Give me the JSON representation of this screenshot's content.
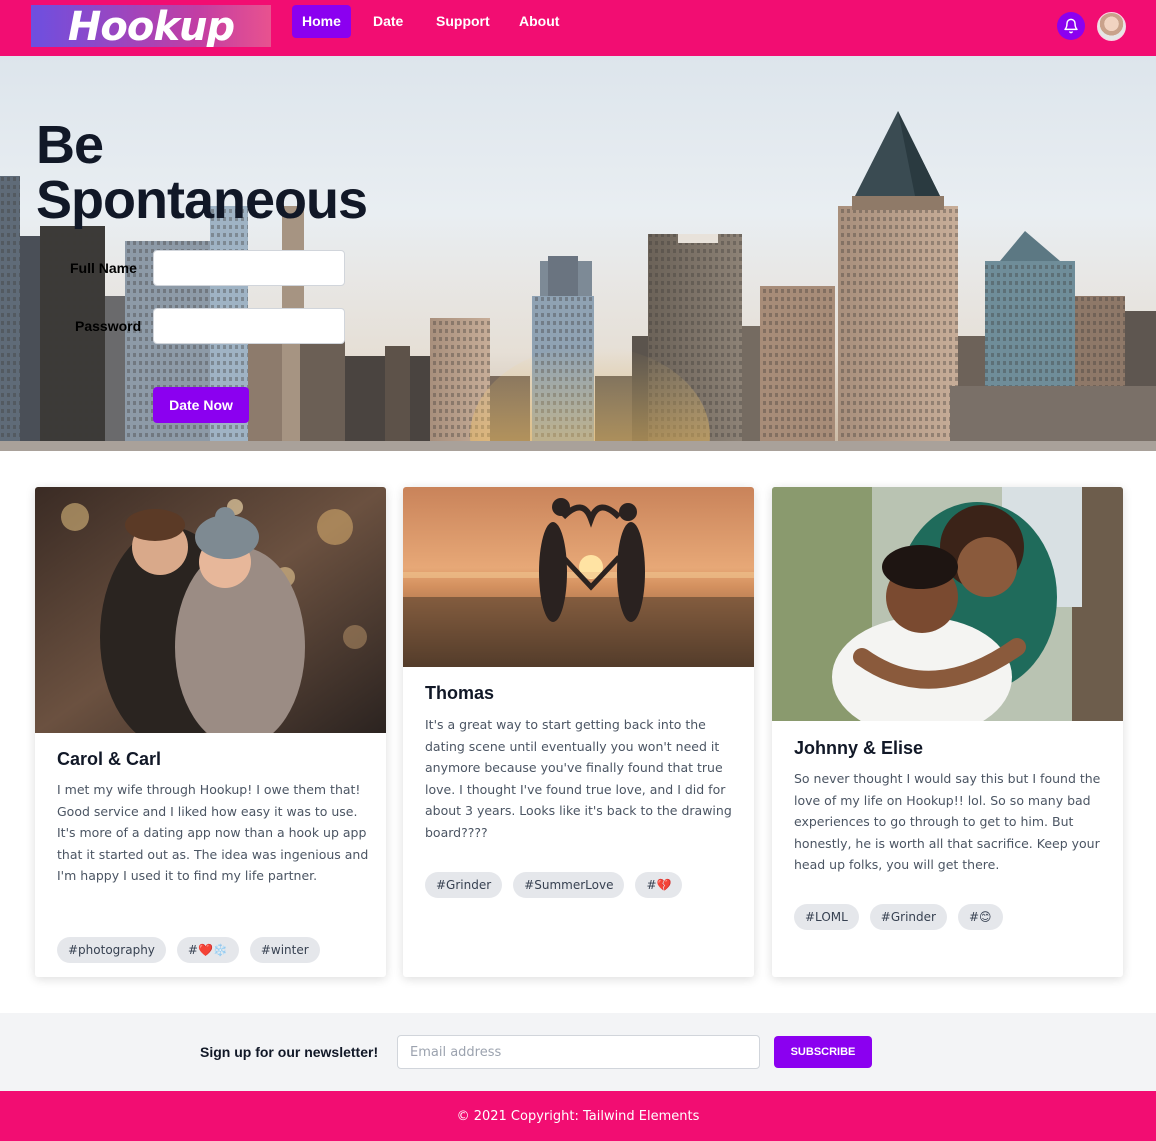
{
  "brand": {
    "logo_text": "Hookup"
  },
  "nav": {
    "links": [
      {
        "label": "Home",
        "active": true
      },
      {
        "label": "Date",
        "active": false
      },
      {
        "label": "Support",
        "active": false
      },
      {
        "label": "About",
        "active": false
      }
    ],
    "icons": [
      "bell-icon",
      "user-avatar"
    ]
  },
  "hero": {
    "title_line1": "Be",
    "title_line2": "Spontaneous",
    "full_name_label": "Full Name",
    "full_name_value": "",
    "password_label": "Password",
    "password_value": "",
    "submit_label": "Date Now"
  },
  "cards": [
    {
      "title": "Carol & Carl",
      "text": "I met my wife through Hookup! I owe them that! Good service and I liked how easy it was to use. It's more of a dating app now than a hook up app that it started out as. The idea was ingenious and I'm happy I used it to find my life partner.",
      "tags": [
        "#photography",
        "#❤️❄️",
        "#winter"
      ]
    },
    {
      "title": "Thomas",
      "text": "It's a great way to start getting back into the dating scene until eventually you won't need it anymore because you've finally found that true love. I thought I've found true love, and I did for about 3 years. Looks like it's back to the drawing board????",
      "tags": [
        "#Grinder",
        "#SummerLove",
        "#💔"
      ]
    },
    {
      "title": "Johnny & Elise",
      "text": "So never thought I would say this but I found the love of my life on Hookup!! lol. So so many bad experiences to go through to get to him. But honestly, he is worth all that sacrifice. Keep your head up folks, you will get there.",
      "tags": [
        "#LOML",
        "#Grinder",
        "#😊"
      ]
    }
  ],
  "newsletter": {
    "label": "Sign up for our newsletter!",
    "email_placeholder": "Email address",
    "email_value": "",
    "button_label": "SUBSCRIBE"
  },
  "footer": {
    "copyright": "© 2021 Copyright: Tailwind Elements"
  },
  "colors": {
    "nav_bg": "#f20d72",
    "accent": "#8b00f0",
    "footer_bg": "#f20d72",
    "newsletter_bg": "#f3f4f6"
  }
}
